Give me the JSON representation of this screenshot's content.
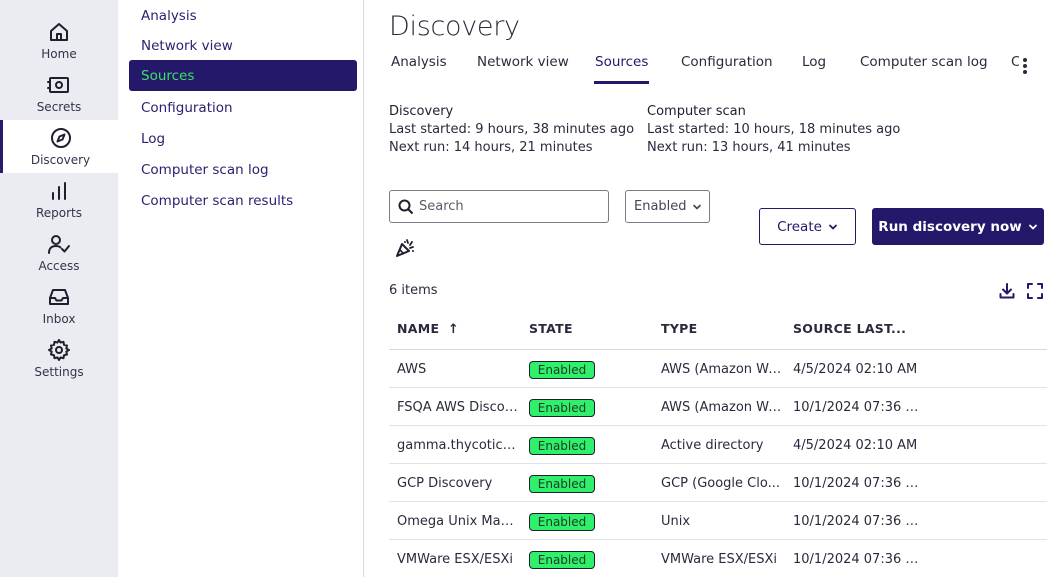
{
  "rail": {
    "items": [
      {
        "label": "Home",
        "icon": "home-icon"
      },
      {
        "label": "Secrets",
        "icon": "safe-icon"
      },
      {
        "label": "Discovery",
        "icon": "compass-icon"
      },
      {
        "label": "Reports",
        "icon": "bar-chart-icon"
      },
      {
        "label": "Access",
        "icon": "user-check-icon"
      },
      {
        "label": "Inbox",
        "icon": "inbox-icon"
      },
      {
        "label": "Settings",
        "icon": "gear-icon"
      }
    ],
    "active": "Discovery"
  },
  "subnav": {
    "items": [
      "Analysis",
      "Network view",
      "Sources",
      "Configuration",
      "Log",
      "Computer scan log",
      "Computer scan results"
    ],
    "active": "Sources"
  },
  "page": {
    "title": "Discovery"
  },
  "tabs": {
    "items": [
      "Analysis",
      "Network view",
      "Sources",
      "Configuration",
      "Log",
      "Computer scan log",
      "C"
    ],
    "active": "Sources"
  },
  "discovery_info": {
    "heading": "Discovery",
    "last_started": "Last started: 9 hours, 38 minutes ago",
    "next_run": "Next run: 14 hours, 21 minutes"
  },
  "computer_scan_info": {
    "heading": "Computer scan",
    "last_started": "Last started: 10 hours, 18 minutes ago",
    "next_run": "Next run: 13 hours, 41 minutes"
  },
  "toolbar": {
    "search_placeholder": "Search",
    "filter_value": "Enabled",
    "create_label": "Create",
    "run_label": "Run discovery now"
  },
  "table": {
    "count_label": "6 items",
    "columns": [
      "NAME",
      "STATE",
      "TYPE",
      "SOURCE LAST..."
    ],
    "sort_indicator": "↑",
    "rows": [
      {
        "name": "AWS",
        "state": "Enabled",
        "type": "AWS (Amazon We...",
        "last": "4/5/2024 02:10 AM"
      },
      {
        "name": "FSQA AWS Discov...",
        "state": "Enabled",
        "type": "AWS (Amazon We...",
        "last": "10/1/2024 07:36 A..."
      },
      {
        "name": "gamma.thycotic....",
        "state": "Enabled",
        "type": "Active directory",
        "last": "4/5/2024 02:10 AM"
      },
      {
        "name": "GCP Discovery",
        "state": "Enabled",
        "type": "GCP (Google Clo...",
        "last": "10/1/2024 07:36 A..."
      },
      {
        "name": "Omega Unix Mac...",
        "state": "Enabled",
        "type": "Unix",
        "last": "10/1/2024 07:36 A..."
      },
      {
        "name": "VMWare ESX/ESXi",
        "state": "Enabled",
        "type": "VMWare ESX/ESXi",
        "last": "10/1/2024 07:36 A..."
      }
    ]
  },
  "colors": {
    "brand": "#24186a",
    "active_text": "#3de06a",
    "badge": "#2ef06a"
  }
}
